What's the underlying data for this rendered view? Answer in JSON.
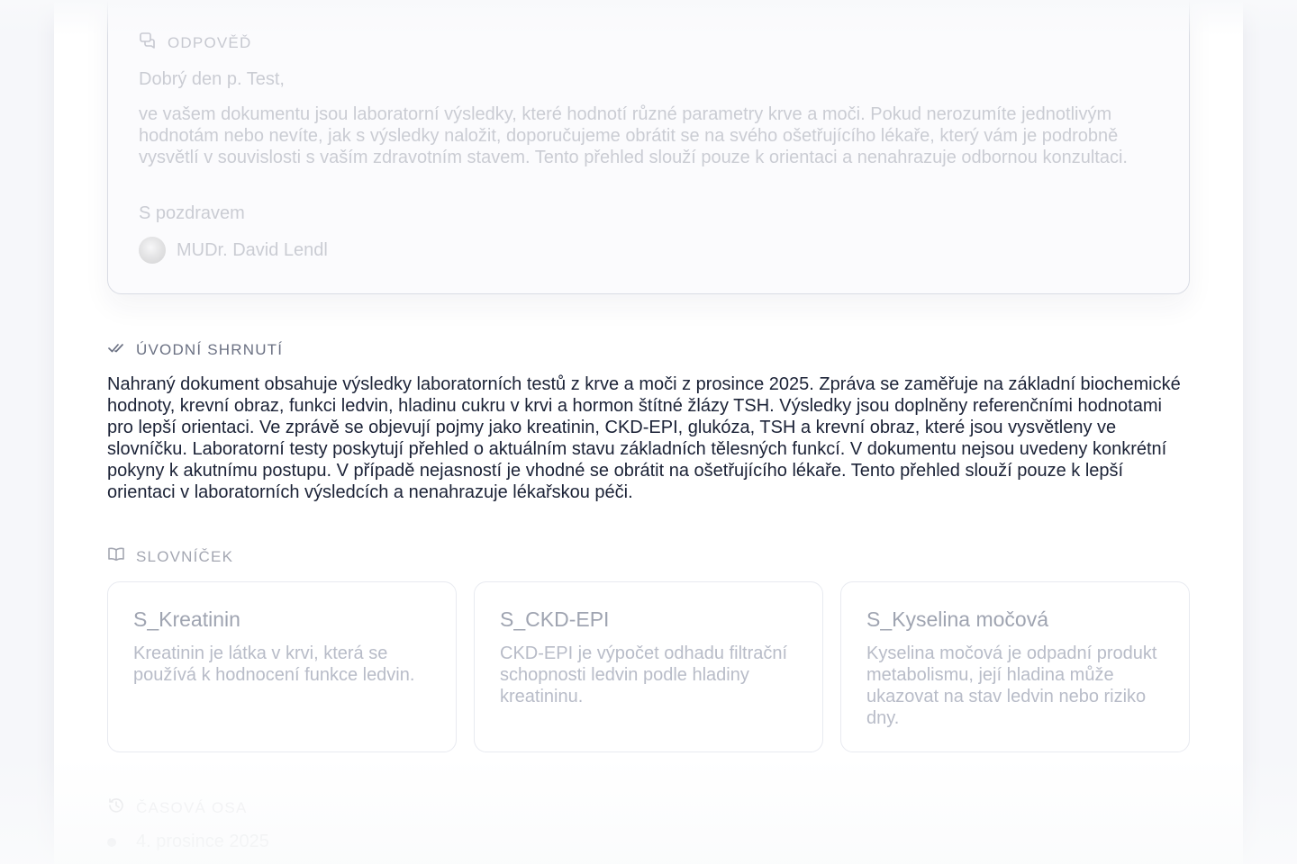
{
  "reply": {
    "heading": "ODPOVĚĎ",
    "greeting": "Dobrý den p. Test,",
    "body": "ve vašem dokumentu jsou laboratorní výsledky, které hodnotí různé parametry krve a moči. Pokud nerozumíte jednotlivým hodnotám nebo nevíte, jak s výsledky naložit, doporučujeme obrátit se na svého ošetřujícího lékaře, který vám je podrobně vysvětlí v souvislosti s vaším zdravotním stavem. Tento přehled slouží pouze k orientaci a nenahrazuje odbornou konzultaci.",
    "signoff": "S pozdravem",
    "doctor": "MUDr. David Lendl"
  },
  "summary": {
    "heading": "ÚVODNÍ SHRNUTÍ",
    "text": "Nahraný dokument obsahuje výsledky laboratorních testů z krve a moči z prosince 2025. Zpráva se zaměřuje na základní biochemické hodnoty, krevní obraz, funkci ledvin, hladinu cukru v krvi a hormon štítné žlázy TSH. Výsledky jsou doplněny referenčními hodnotami pro lepší orientaci. Ve zprávě se objevují pojmy jako kreatinin, CKD-EPI, glukóza, TSH a krevní obraz, které jsou vysvětleny ve slovníčku. Laboratorní testy poskytují přehled o aktuálním stavu základních tělesných funkcí. V dokumentu nejsou uvedeny konkrétní pokyny k akutnímu postupu. V případě nejasností je vhodné se obrátit na ošetřujícího lékaře. Tento přehled slouží pouze k lepší orientaci v laboratorních výsledcích a nenahrazuje lékařskou péči."
  },
  "glossary": {
    "heading": "SLOVNÍČEK",
    "items": [
      {
        "title": "S_Kreatinin",
        "text": "Kreatinin je látka v krvi, která se používá k hodnocení funkce ledvin."
      },
      {
        "title": "S_CKD-EPI",
        "text": "CKD-EPI je výpočet odhadu filtrační schopnosti ledvin podle hladiny kreatininu."
      },
      {
        "title": "S_Kyselina močová",
        "text": "Kyselina močová je odpadní produkt metabolismu, její hladina může ukazovat na stav ledvin nebo riziko dny."
      }
    ]
  },
  "timeline": {
    "heading": "ČASOVÁ OSA",
    "items": [
      {
        "date": "4. prosince 2025"
      }
    ]
  },
  "icons": {
    "reply": "chat-bubbles-icon",
    "summary": "double-check-icon",
    "glossary": "open-book-icon",
    "timeline": "history-clock-icon"
  }
}
